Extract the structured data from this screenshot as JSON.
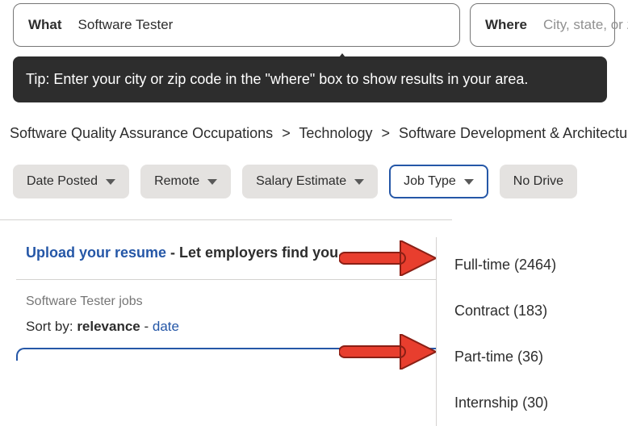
{
  "search": {
    "what_label": "What",
    "what_value": "Software Tester",
    "where_label": "Where",
    "where_placeholder": "City, state, or zip"
  },
  "tooltip": "Tip: Enter your city or zip code in the \"where\" box to show results in your area.",
  "breadcrumb": {
    "items": [
      "Software Quality Assurance Occupations",
      "Technology",
      "Software Development & Architecture"
    ],
    "sep": ">"
  },
  "filters": {
    "date_posted": "Date Posted",
    "remote": "Remote",
    "salary_estimate": "Salary Estimate",
    "job_type": "Job Type",
    "no_drive": "No Drive"
  },
  "job_type_options": [
    {
      "label": "Full-time",
      "count": "2464"
    },
    {
      "label": "Contract",
      "count": "183"
    },
    {
      "label": "Part-time",
      "count": "36"
    },
    {
      "label": "Internship",
      "count": "30"
    }
  ],
  "results": {
    "upload_link": "Upload your resume",
    "upload_suffix": " - Let employers find you",
    "jobs_title": "Software Tester jobs",
    "sort_prefix": "Sort by: ",
    "sort_relevance": "relevance",
    "sort_sep": " - ",
    "sort_date": "date"
  },
  "annotation": {
    "arrow_color": "#e83e2e"
  }
}
